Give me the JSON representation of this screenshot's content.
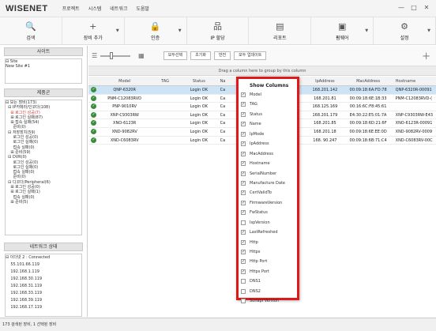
{
  "app": {
    "logo": "WISENET",
    "menus": [
      "프로젝트",
      "시스템",
      "네트워크",
      "도움말"
    ],
    "window_controls": [
      "—",
      "□",
      "✕"
    ]
  },
  "toolbar": [
    {
      "label": "검색",
      "icon": "search-icon",
      "glyph": "🔍",
      "arrow": false
    },
    {
      "label": "장비 추가",
      "icon": "plus-icon",
      "glyph": "+",
      "arrow": true
    },
    {
      "label": "인증",
      "icon": "lock-icon",
      "glyph": "🔒",
      "arrow": true
    },
    {
      "label": "IP 할당",
      "icon": "network-icon",
      "glyph": "品",
      "arrow": false
    },
    {
      "label": "리포트",
      "icon": "report-icon",
      "glyph": "▤",
      "arrow": false
    },
    {
      "label": "펌웨어",
      "icon": "firmware-icon",
      "glyph": "▣",
      "arrow": true
    },
    {
      "label": "설정",
      "icon": "gear-icon",
      "glyph": "⚙",
      "arrow": true
    }
  ],
  "left": {
    "site_title": "사이트",
    "site_tree": [
      "⊟ Site",
      "    New Site #1"
    ],
    "group_title": "제품군",
    "group_tree": [
      {
        "text": "⊟ 모든 장비(173)",
        "red": false
      },
      {
        "text": "  ⊟ IP카메라/인코더(108)",
        "red": false
      },
      {
        "text": "    ⊞ 로그인 성공(7)",
        "red": true
      },
      {
        "text": "    ⊞ 로그인 실패(87)",
        "red": false
      },
      {
        "text": "    ⊞ 접속 실패(54)",
        "red": false
      },
      {
        "text": "      준비(0)",
        "red": false
      },
      {
        "text": "  ⊟ 저장장치(59)",
        "red": false
      },
      {
        "text": "      로그인 성공(0)",
        "red": false
      },
      {
        "text": "      로그인 실패(0)",
        "red": false
      },
      {
        "text": "      접속 실패(0)",
        "red": false
      },
      {
        "text": "    ⊞ 준비(59)",
        "red": false
      },
      {
        "text": "  ⊟ DVR(0)",
        "red": false
      },
      {
        "text": "      로그인 성공(0)",
        "red": false
      },
      {
        "text": "      로그인 실패(0)",
        "red": false
      },
      {
        "text": "      접속 실패(0)",
        "red": false
      },
      {
        "text": "      준비(0)",
        "red": false
      },
      {
        "text": "  ⊟ 디코더/Peripheral(6)",
        "red": false
      },
      {
        "text": "    ⊞ 로그인 성공(0)",
        "red": false
      },
      {
        "text": "    ⊞ 로그인 실패(1)",
        "red": false
      },
      {
        "text": "      접속 실패(0)",
        "red": false
      },
      {
        "text": "    ⊞ 준비(5)",
        "red": false
      }
    ],
    "net_title": "네트워크 상태",
    "net_tree": [
      "⊟ 이더넷 2 : Connected",
      "    55.101.66.119",
      "    192.168.1.119",
      "    192.168.30.119",
      "    192.168.31.119",
      "    192.168.33.119",
      "    192.168.39.119",
      "    192.168.17.119"
    ]
  },
  "filter": {
    "buttons": [
      "모두선택",
      "초기화",
      "반전",
      "모두 업데이트"
    ]
  },
  "grid": {
    "group_hint": "Drag a column here to group by this column",
    "headers": [
      "",
      "Model",
      "TAG",
      "Status",
      "Na",
      "",
      "IpAddress",
      "MacAddress",
      "Hostname"
    ],
    "rows": [
      {
        "model": "QNP-6320R",
        "tag": "",
        "status": "Login OK",
        "name": "Ca",
        "ip": "168.201.142",
        "mac": "00:09:18:6A:FD:78",
        "host": "QNP-6320R-00091",
        "selected": true
      },
      {
        "model": "PNM-C12083RVD",
        "tag": "",
        "status": "Login OK",
        "name": "Ca",
        "ip": "168.201.81",
        "mac": "00:09:18:6E:1B:33",
        "host": "PNM-C12083RVD-(",
        "selected": false
      },
      {
        "model": "PNP-9010RV",
        "tag": "",
        "status": "Login OK",
        "name": "Ca",
        "ip": "168.125.169",
        "mac": "00:16:6C:F8:45:61",
        "host": "",
        "selected": false
      },
      {
        "model": "XNP-C9303RW",
        "tag": "",
        "status": "Login OK",
        "name": "Ca",
        "ip": "168.201.179",
        "mac": "E4:30:22:E5:01:7A",
        "host": "XNP-C9303RW-E43",
        "selected": false
      },
      {
        "model": "XNO-6123R",
        "tag": "",
        "status": "Login OK",
        "name": "Ca",
        "ip": "168.201.85",
        "mac": "00:09:18:6D:21:6F",
        "host": "XNO-6123R-00091",
        "selected": false
      },
      {
        "model": "XND-9082RV",
        "tag": "",
        "status": "Login OK",
        "name": "Ca",
        "ip": "168.201.18",
        "mac": "00:09:18:6E:EE:0D",
        "host": "XND-9082RV-0009",
        "selected": false
      },
      {
        "model": "XND-C6083RV",
        "tag": "",
        "status": "Login OK",
        "name": "Ca",
        "ip": "168. 90.247",
        "mac": "00:09:18:6B:71:C4",
        "host": "XND-C6083RV-00C",
        "selected": false
      }
    ]
  },
  "column_menu": {
    "title": "Show Columns",
    "items": [
      {
        "label": "Model",
        "checked": true
      },
      {
        "label": "TAG",
        "checked": true
      },
      {
        "label": "Status",
        "checked": true
      },
      {
        "label": "Name",
        "checked": true
      },
      {
        "label": "IpMode",
        "checked": true
      },
      {
        "label": "IpAddress",
        "checked": true
      },
      {
        "label": "MacAddress",
        "checked": true
      },
      {
        "label": "Hostname",
        "checked": true
      },
      {
        "label": "SerialNumber",
        "checked": true
      },
      {
        "label": "Manufacture Date",
        "checked": true
      },
      {
        "label": "CertValidTo",
        "checked": true
      },
      {
        "label": "FirmwareVersion",
        "checked": true
      },
      {
        "label": "FwStatus",
        "checked": true
      },
      {
        "label": "IspVersion",
        "checked": false
      },
      {
        "label": "LastRefreshed",
        "checked": true
      },
      {
        "label": "Http",
        "checked": true
      },
      {
        "label": "Https",
        "checked": true
      },
      {
        "label": "Http Port",
        "checked": true
      },
      {
        "label": "Https Port",
        "checked": true
      },
      {
        "label": "DNS1",
        "checked": false
      },
      {
        "label": "DNS2",
        "checked": false
      },
      {
        "label": "Sunapi Version",
        "checked": false
      }
    ]
  },
  "status": {
    "text": "173 검색된 장비, 1 선택된 장비"
  }
}
